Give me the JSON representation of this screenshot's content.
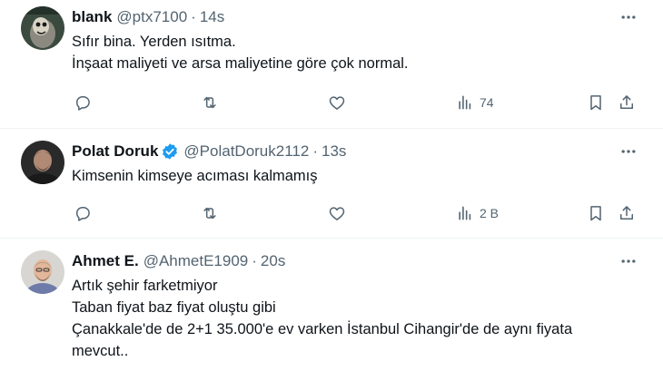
{
  "tweets": [
    {
      "name": "blank",
      "handle": "@ptx7100",
      "separator": "·",
      "time": "14s",
      "verified": false,
      "lines": [
        "Sıfır bina. Yerden ısıtma.",
        "İnşaat maliyeti ve arsa maliyetine göre çok normal."
      ],
      "views": "74",
      "show_actions": true
    },
    {
      "name": "Polat Doruk",
      "handle": "@PolatDoruk2112",
      "separator": "·",
      "time": "13s",
      "verified": true,
      "lines": [
        "Kimsenin kimseye acıması kalmamış"
      ],
      "views": "2 B",
      "show_actions": true
    },
    {
      "name": "Ahmet E.",
      "handle": "@AhmetE1909",
      "separator": "·",
      "time": "20s",
      "verified": false,
      "lines": [
        "Artık şehir farketmiyor",
        "Taban fiyat baz fiyat oluştu gibi",
        "Çanakkale'de de 2+1 35.000'e ev varken İstanbul Cihangir'de de aynı fiyata",
        "mevcut.."
      ],
      "show_actions": false
    }
  ],
  "colors": {
    "text_primary": "#0f1419",
    "text_secondary": "#536471",
    "verified_blue": "#1d9bf0",
    "divider": "#eff3f4"
  },
  "icons": [
    "more-icon",
    "reply-icon",
    "retweet-icon",
    "like-icon",
    "views-icon",
    "bookmark-icon",
    "share-icon",
    "verified-badge-icon"
  ]
}
